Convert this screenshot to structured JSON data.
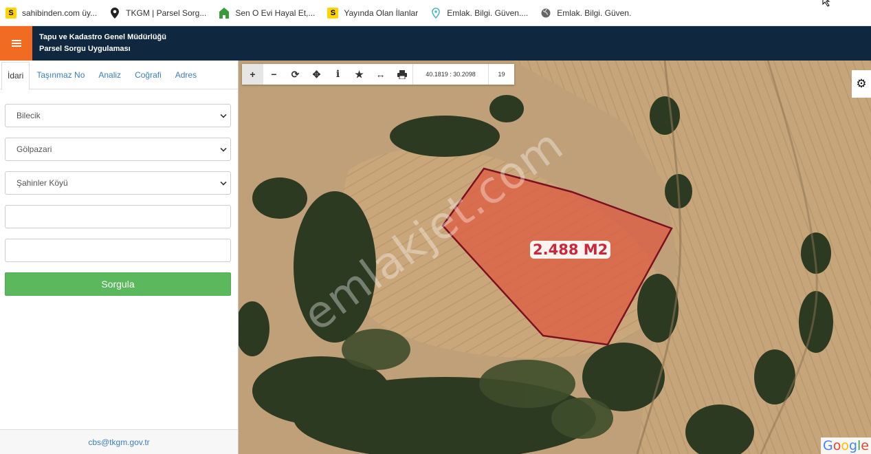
{
  "bookmarks": [
    {
      "label": "sahibinden.com üy...",
      "icon": "sahibinden-s-icon"
    },
    {
      "label": "TKGM | Parsel Sorg...",
      "icon": "map-pin-icon"
    },
    {
      "label": "Sen O Evi Hayal Et,...",
      "icon": "home-icon"
    },
    {
      "label": "Yayında Olan İlanlar",
      "icon": "sahibinden-s-icon"
    },
    {
      "label": "Emlak. Bilgi. Güven....",
      "icon": "map-pin-outline-icon"
    },
    {
      "label": "Emlak. Bilgi. Güven.",
      "icon": "globe-icon"
    }
  ],
  "header": {
    "title_line1": "Tapu ve Kadastro Genel Müdürlüğü",
    "title_line2": "Parsel Sorgu Uygulaması"
  },
  "tabs": [
    {
      "label": "İdari",
      "active": true
    },
    {
      "label": "Taşınmaz No",
      "active": false
    },
    {
      "label": "Analiz",
      "active": false
    },
    {
      "label": "Coğrafi",
      "active": false
    },
    {
      "label": "Adres",
      "active": false
    }
  ],
  "form": {
    "il": "Bilecik",
    "ilce": "Gölpazari",
    "mahalle": "Şahinler Köyü",
    "ada": "",
    "parsel": "",
    "submit_label": "Sorgula"
  },
  "footer": {
    "email": "cbs@tkgm.gov.tr"
  },
  "map": {
    "coordinates": "40.1819 : 30.2098",
    "zoom": "19",
    "area_label": "2.488 M2",
    "watermark": "emlakjet.com",
    "attribution": "Google"
  },
  "colors": {
    "header_bg": "#10283f",
    "menu_accent": "#f26b22",
    "submit_green": "#5cb85c",
    "parcel_fill": "#e0553d",
    "parcel_border": "#7a1020",
    "area_label_text": "#c8283a"
  }
}
